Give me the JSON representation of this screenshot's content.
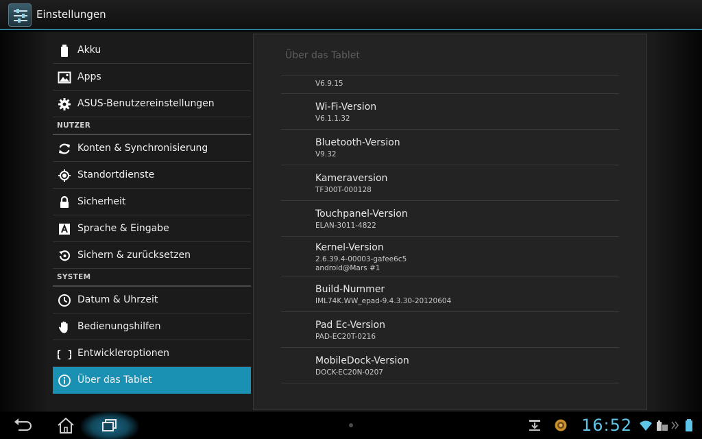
{
  "app": {
    "title": "Einstellungen",
    "icon": "settings-sliders-icon"
  },
  "sidebar": {
    "items": [
      {
        "label": "Akku",
        "icon": "battery-icon"
      },
      {
        "label": "Apps",
        "icon": "apps-icon"
      },
      {
        "label": "ASUS-Benutzereinstellungen",
        "icon": "gear-icon"
      }
    ],
    "header_user": "NUTZER",
    "user_items": [
      {
        "label": "Konten & Synchronisierung",
        "icon": "sync-icon"
      },
      {
        "label": "Standortdienste",
        "icon": "location-icon"
      },
      {
        "label": "Sicherheit",
        "icon": "lock-icon"
      },
      {
        "label": "Sprache & Eingabe",
        "icon": "language-icon"
      },
      {
        "label": "Sichern & zurücksetzen",
        "icon": "backup-icon"
      }
    ],
    "header_system": "SYSTEM",
    "system_items": [
      {
        "label": "Datum & Uhrzeit",
        "icon": "clock-icon"
      },
      {
        "label": "Bedienungshilfen",
        "icon": "hand-icon"
      },
      {
        "label": "Entwickleroptionen",
        "icon": "braces-icon"
      },
      {
        "label": "Über das Tablet",
        "icon": "info-icon",
        "selected": true
      }
    ]
  },
  "detail": {
    "title": "Über das Tablet",
    "rows": [
      {
        "title": "",
        "lines": [
          "V6.9.15"
        ]
      },
      {
        "title": "Wi-Fi-Version",
        "lines": [
          "V6.1.1.32"
        ]
      },
      {
        "title": "Bluetooth-Version",
        "lines": [
          "V9.32"
        ]
      },
      {
        "title": "Kameraversion",
        "lines": [
          "TF300T-000128"
        ]
      },
      {
        "title": "Touchpanel-Version",
        "lines": [
          "ELAN-3011-4822"
        ]
      },
      {
        "title": "Kernel-Version",
        "lines": [
          "2.6.39.4-00003-gafee6c5",
          "android@Mars #1"
        ]
      },
      {
        "title": "Build-Nummer",
        "lines": [
          "IML74K.WW_epad-9.4.3.30-20120604"
        ]
      },
      {
        "title": "Pad Ec-Version",
        "lines": [
          "PAD-EC20T-0216"
        ]
      },
      {
        "title": "MobileDock-Version",
        "lines": [
          "DOCK-EC20N-0207"
        ]
      }
    ]
  },
  "statusbar": {
    "time": "16:52",
    "icons": [
      "download-icon",
      "notification-app-icon",
      "wifi-icon",
      "battery-dock-icon",
      "battery-icon"
    ]
  },
  "colors": {
    "accent": "#1a90b3",
    "clock": "#5ec4e8"
  }
}
